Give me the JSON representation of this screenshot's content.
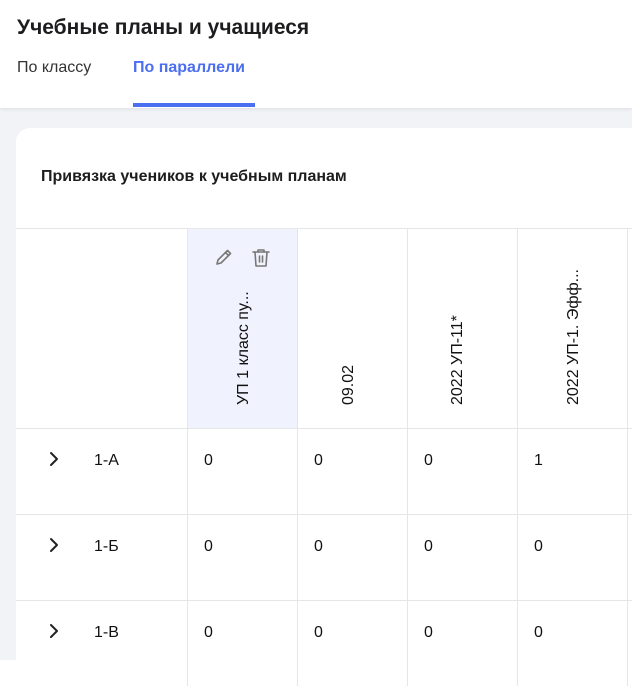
{
  "header": {
    "title": "Учебные планы и учащиеся",
    "tabs": [
      {
        "label": "По классу",
        "active": false
      },
      {
        "label": "По параллели",
        "active": true
      }
    ]
  },
  "card": {
    "title": "Привязка учеников к учебным планам"
  },
  "table": {
    "columns": [
      {
        "label": "УП 1 класс пу...",
        "selected": true
      },
      {
        "label": "09.02",
        "selected": false
      },
      {
        "label": "2022 УП-11*",
        "selected": false
      },
      {
        "label": "2022 УП-1. Эфф...",
        "selected": false
      }
    ],
    "rows": [
      {
        "label": "1-А",
        "values": [
          "0",
          "0",
          "0",
          "1"
        ]
      },
      {
        "label": "1-Б",
        "values": [
          "0",
          "0",
          "0",
          "0"
        ]
      },
      {
        "label": "1-В",
        "values": [
          "0",
          "0",
          "0",
          "0"
        ]
      }
    ]
  },
  "icons": {
    "edit": "pencil-icon",
    "delete": "trash-icon",
    "expand": "chevron-right-icon"
  },
  "colors": {
    "accent": "#4c6ef0",
    "selected_column_bg": "#f0f3fd",
    "page_background": "#f2f3f6",
    "border": "#e4e6ea"
  }
}
